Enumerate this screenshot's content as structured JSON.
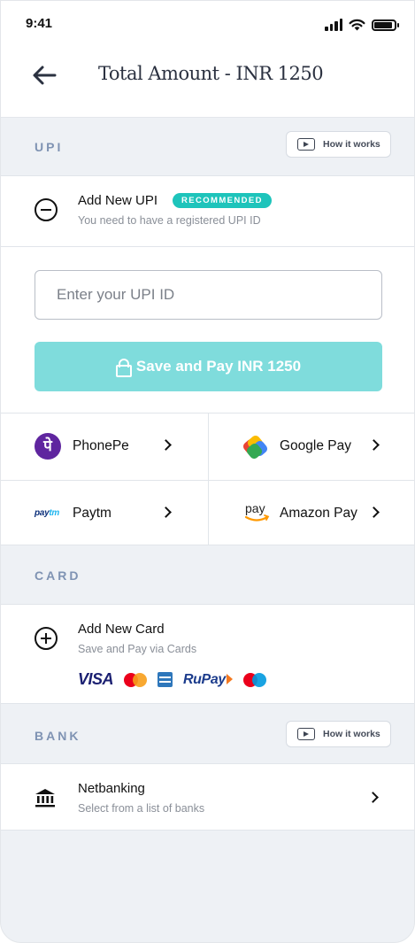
{
  "status_bar": {
    "time": "9:41"
  },
  "header": {
    "title": "Total Amount - INR 1250"
  },
  "upi_section": {
    "label": "UPI",
    "how_it_works": "How it works",
    "add_title": "Add New UPI",
    "badge": "RECOMMENDED",
    "add_subtitle": "You need to have a registered UPI ID",
    "input_placeholder": "Enter your UPI ID",
    "save_button": "Save and Pay INR 1250",
    "apps": [
      {
        "name": "PhonePe",
        "icon": "phonepe-logo"
      },
      {
        "name": "Google Pay",
        "icon": "google-pay-logo"
      },
      {
        "name": "Paytm",
        "icon": "paytm-logo"
      },
      {
        "name": "Amazon Pay",
        "icon": "amazon-pay-logo"
      }
    ],
    "phonepe_glyph": "पे",
    "paytm_logo_a": "pay",
    "paytm_logo_b": "tm",
    "amazon_logo": "pay"
  },
  "card_section": {
    "label": "CARD",
    "add_title": "Add New Card",
    "add_subtitle": "Save and Pay via Cards",
    "brands": [
      "VISA",
      "Mastercard",
      "American Express",
      "RuPay",
      "Maestro"
    ],
    "visa_text": "VISA",
    "rupay_text": "RuPay"
  },
  "bank_section": {
    "label": "BANK",
    "how_it_works": "How it works",
    "netbanking_title": "Netbanking",
    "netbanking_subtitle": "Select from a list of banks"
  },
  "colors": {
    "accent": "#1ec4bb",
    "button_disabled": "#7fdcdc",
    "section_label": "#7f93b3",
    "background": "#eef1f5"
  }
}
